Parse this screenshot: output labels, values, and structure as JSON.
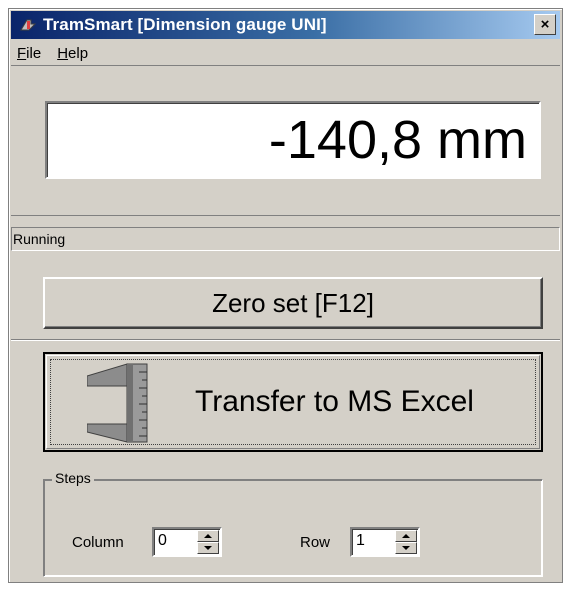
{
  "window": {
    "title": "TramSmart [Dimension gauge UNI]",
    "close_label": "×"
  },
  "menu": {
    "items": [
      {
        "label": "File",
        "accel": "F",
        "rest": "ile"
      },
      {
        "label": "Help",
        "accel": "H",
        "rest": "elp"
      }
    ]
  },
  "display": {
    "value": "-140,8 mm"
  },
  "status": {
    "text": "Running"
  },
  "buttons": {
    "zero_label": "Zero set [F12]",
    "transfer_label": "Transfer to MS Excel",
    "transfer_icon": "caliper-icon"
  },
  "steps": {
    "legend": "Steps",
    "column_label": "Column",
    "column_value": "0",
    "row_label": "Row",
    "row_value": "1"
  },
  "colors": {
    "face": "#d4d0c8",
    "title_start": "#0a246a",
    "title_end": "#a6caf0"
  }
}
